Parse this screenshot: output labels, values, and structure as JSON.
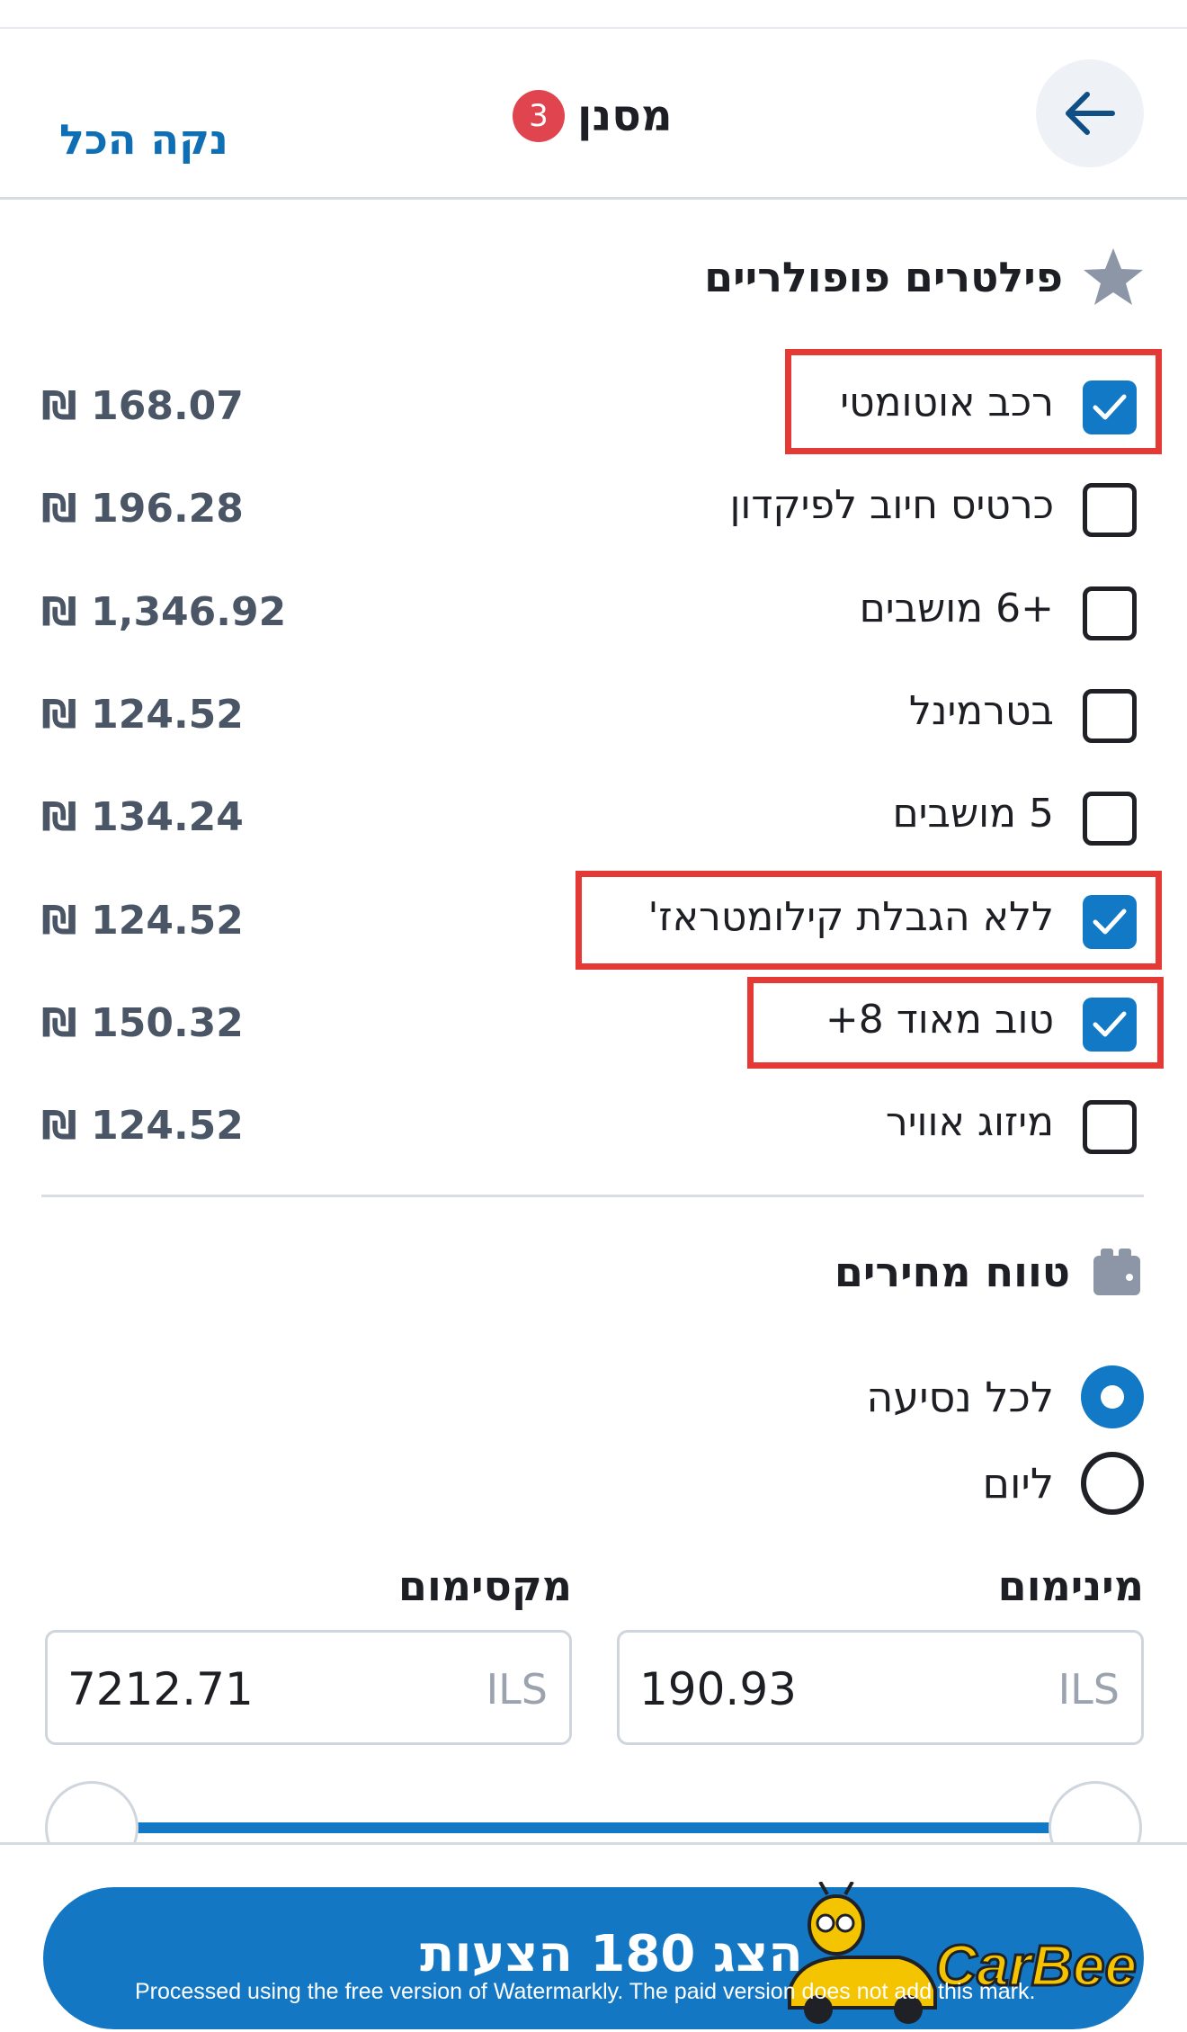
{
  "header": {
    "title": "מסנן",
    "badge_count": "3",
    "clear_all": "נקה הכל"
  },
  "popular": {
    "title": "פילטרים פופולריים",
    "items": [
      {
        "label": "רכב אוטומטי",
        "price": "₪ 168.07",
        "checked": true
      },
      {
        "label": "כרטיס חיוב לפיקדון",
        "price": "₪ 196.28",
        "checked": false
      },
      {
        "label": "+6 מושבים",
        "price": "₪ 1,346.92",
        "checked": false
      },
      {
        "label": "בטרמינל",
        "price": "₪ 124.52",
        "checked": false
      },
      {
        "label": "5 מושבים",
        "price": "₪ 134.24",
        "checked": false
      },
      {
        "label": "ללא הגבלת קילומטראז'",
        "price": "₪ 124.52",
        "checked": true
      },
      {
        "label": "טוב מאוד 8+",
        "price": "₪ 150.32",
        "checked": true
      },
      {
        "label": "מיזוג אוויר",
        "price": "₪ 124.52",
        "checked": false
      }
    ]
  },
  "price_range": {
    "title": "טווח מחירים",
    "options": [
      {
        "label": "לכל נסיעה",
        "selected": true
      },
      {
        "label": "ליום",
        "selected": false
      }
    ],
    "min": {
      "label": "מינימום",
      "value": "190.93",
      "unit": "ILS"
    },
    "max": {
      "label": "מקסימום",
      "value": "7212.71",
      "unit": "ILS"
    },
    "slider_fill": [
      0,
      1
    ]
  },
  "cta": {
    "label": "הצג 180 הצעות"
  },
  "watermark": {
    "text": "Processed using the free version of Watermarkly. The paid version does not add this mark.",
    "logo_text": "CarBee"
  },
  "colors": {
    "accent": "#1279c7",
    "badge": "#e0444e",
    "highlight": "#e53935",
    "link": "#0f6fb4"
  }
}
